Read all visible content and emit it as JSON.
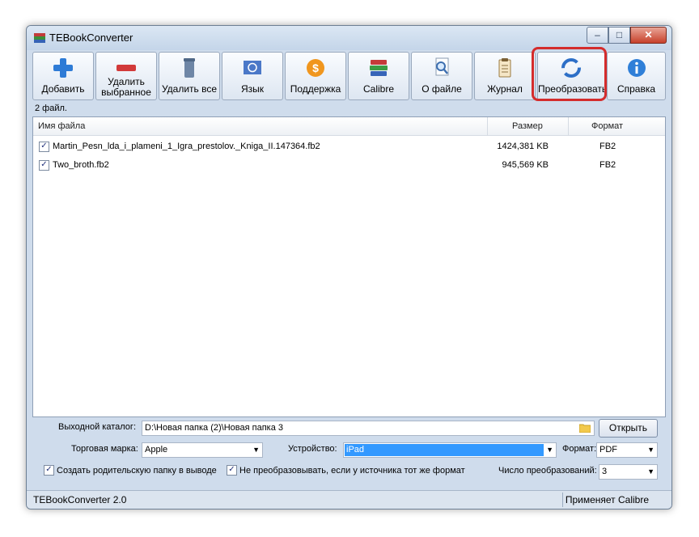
{
  "window": {
    "title": "TEBookConverter"
  },
  "window_controls": {
    "minimize": "‒",
    "maximize": "□",
    "close": "✕"
  },
  "toolbar": {
    "buttons": [
      {
        "label": "Добавить",
        "icon": "plus-icon"
      },
      {
        "label": "Удалить выбранное",
        "icon": "minus-icon"
      },
      {
        "label": "Удалить все",
        "icon": "trash-icon"
      },
      {
        "label": "Язык",
        "icon": "globe-flag-icon"
      },
      {
        "label": "Поддержка",
        "icon": "dollar-icon"
      },
      {
        "label": "Calibre",
        "icon": "books-icon"
      },
      {
        "label": "О файле",
        "icon": "magnifier-icon"
      },
      {
        "label": "Журнал",
        "icon": "clipboard-icon"
      },
      {
        "label": "Преобразовать",
        "icon": "convert-icon"
      },
      {
        "label": "Справка",
        "icon": "info-icon"
      }
    ]
  },
  "file_count": "2 файл.",
  "list": {
    "columns": {
      "name": "Имя файла",
      "size": "Размер",
      "format": "Формат"
    },
    "rows": [
      {
        "checked": true,
        "name": "Martin_Pesn_lda_i_plameni_1_Igra_prestolov._Kniga_II.147364.fb2",
        "size": "1424,381 KB",
        "format": "FB2"
      },
      {
        "checked": true,
        "name": "Two_broth.fb2",
        "size": "945,569 KB",
        "format": "FB2"
      }
    ]
  },
  "bottom": {
    "output_dir_label": "Выходной каталог:",
    "output_dir_value": "D:\\Новая папка (2)\\Новая папка 3",
    "open_button": "Открыть",
    "brand_label": "Торговая марка:",
    "brand_value": "Apple",
    "device_label": "Устройство:",
    "device_value": "iPad",
    "format_label": "Формат:",
    "format_value": "PDF",
    "create_parent_label": "Создать родительскую папку в выводе",
    "no_convert_label": "Не преобразовывать, если у источника тот же формат",
    "conversions_label": "Число преобразований:",
    "conversions_value": "3"
  },
  "status": {
    "left": "TEBookConverter 2.0",
    "right": "Применяет Calibre"
  },
  "colors": {
    "highlight": "#d42c2c",
    "selection": "#3399ff"
  }
}
